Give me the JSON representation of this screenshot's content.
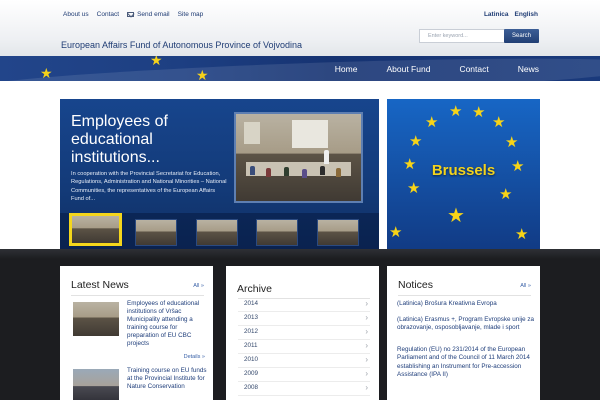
{
  "header": {
    "links": [
      "About us",
      "Contact",
      "Send email",
      "Site map"
    ],
    "languages": [
      "Latinica",
      "English"
    ],
    "site_title": "European Affairs Fund of Autonomous Province of Vojvodina",
    "search": {
      "placeholder": "Enter keyword...",
      "button_label": "Search"
    }
  },
  "nav": {
    "items": [
      "Home",
      "About Fund",
      "Contact",
      "News"
    ]
  },
  "slider": {
    "title": "Employees of educational institutions...",
    "text": "In cooperation with the Provincial Secretariat for Education, Regulations, Administration and National Minorities – National Communities, the representatives of the European Affairs Fund of..."
  },
  "banner": {
    "label": "Brussels"
  },
  "latest_news": {
    "heading": "Latest News",
    "all_label": "All »",
    "items": [
      {
        "title": "Employees of educational institutions of Vršac Municipality attending a training course for preparation of EU CBC projects",
        "details_label": "Details »"
      },
      {
        "title": "Training course on EU funds at the Provincial Institute for Nature Conservation"
      }
    ]
  },
  "archive": {
    "heading": "Archive",
    "years": [
      "2014",
      "2013",
      "2012",
      "2011",
      "2010",
      "2009",
      "2008"
    ]
  },
  "notices": {
    "heading": "Notices",
    "all_label": "All »",
    "items": [
      "(Latinica) Brošura Kreativna Evropa",
      "(Latinica) Erasmus +, Program Evropske unije za obrazovanje, osposobljavanje, mlade i sport",
      "Regulation (EU) no 231/2014 of the European Parliament and of the Council of 11 March 2014 establishing an Instrument for Pre-accession Assistance (IPA II)"
    ]
  },
  "colors": {
    "brand_blue": "#1f3c74",
    "eu_yellow": "#f4d61c",
    "link_blue": "#3a62a8"
  }
}
